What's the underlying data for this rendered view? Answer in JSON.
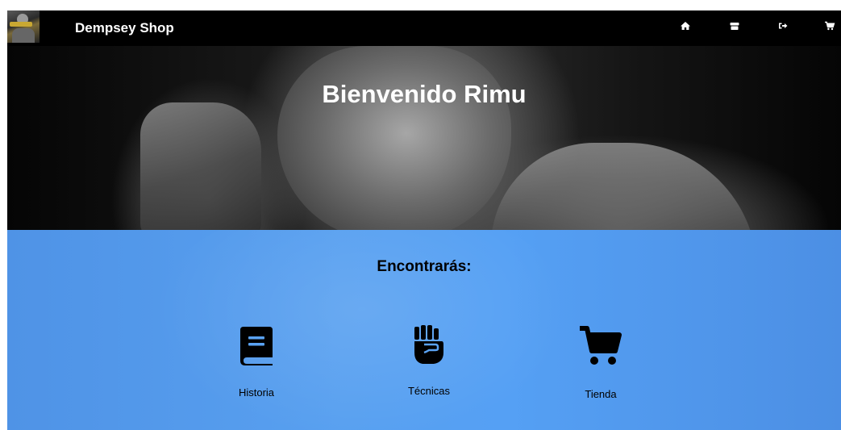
{
  "navbar": {
    "brand": "Dempsey Shop",
    "icons": [
      "home-icon",
      "store-icon",
      "logout-icon",
      "cart-icon"
    ]
  },
  "hero": {
    "title": "Bienvenido Rimu"
  },
  "features": {
    "title": "Encontrarás:",
    "items": [
      {
        "label": "Historia",
        "icon": "book-icon"
      },
      {
        "label": "Técnicas",
        "icon": "fist-icon"
      },
      {
        "label": "Tienda",
        "icon": "cart-icon"
      }
    ]
  },
  "colors": {
    "navbar_bg": "#000000",
    "section_blue": "#55a0f4",
    "text_dark": "#000000",
    "text_light": "#ffffff"
  }
}
